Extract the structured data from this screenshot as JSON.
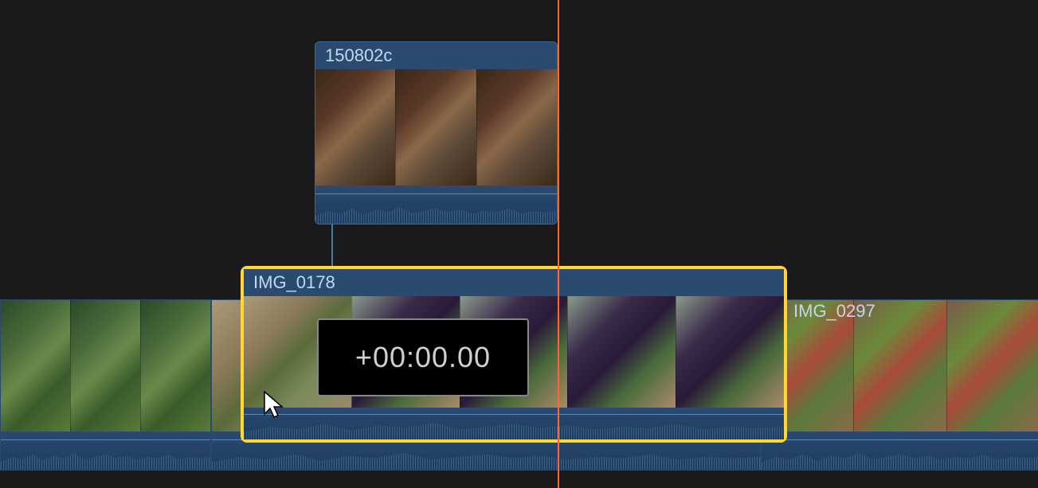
{
  "clips": {
    "connected": {
      "label": "150802c"
    },
    "selected": {
      "label": "IMG_0178"
    },
    "right": {
      "label": "IMG_0297"
    }
  },
  "timecode": {
    "value": "+00:00.00"
  },
  "colors": {
    "selection": "#ffd633",
    "playhead": "#ff6633",
    "clip_bg": "#1e3a5f"
  }
}
